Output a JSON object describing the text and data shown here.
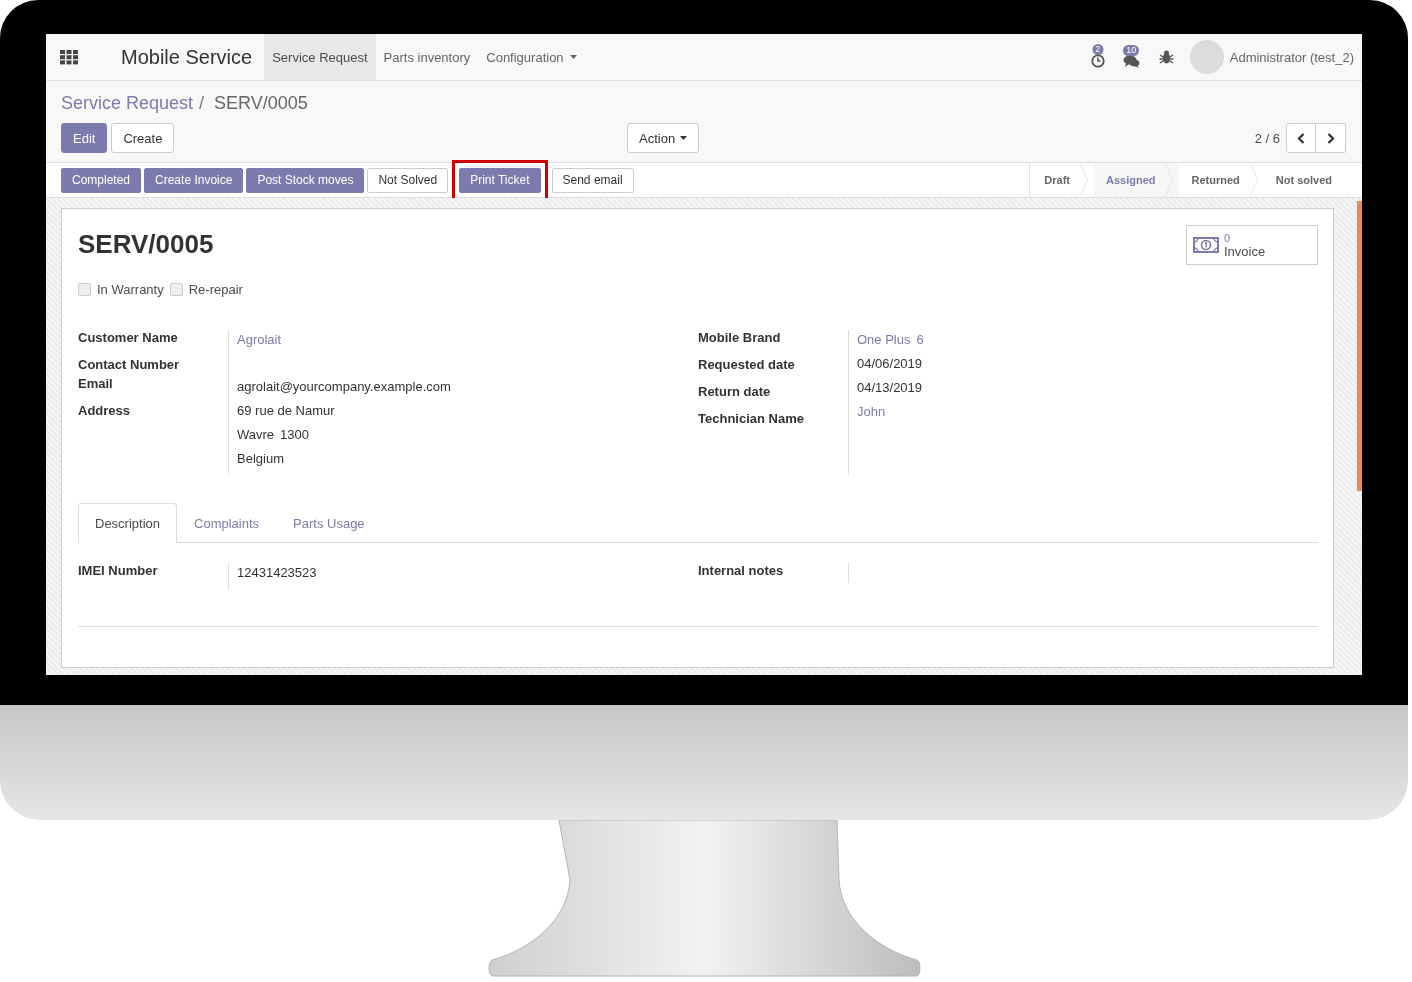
{
  "navbar": {
    "app_title": "Mobile Service",
    "menus": [
      {
        "label": "Service Request",
        "selected": true,
        "dropdown": false
      },
      {
        "label": "Parts inventory",
        "selected": false,
        "dropdown": false
      },
      {
        "label": "Configuration",
        "selected": false,
        "dropdown": true
      }
    ],
    "activity_count": "2",
    "message_count": "10",
    "user": "Administrator (test_2)"
  },
  "breadcrumb": {
    "parent": "Service Request",
    "separator": "/",
    "current": "SERV/0005"
  },
  "actions": [
    {
      "label": "Edit",
      "primary": true
    },
    {
      "label": "Create",
      "primary": false
    }
  ],
  "action_menu": "Action",
  "pager": "2 / 6",
  "header_buttons": [
    {
      "label": "Completed",
      "primary": true,
      "highlighted": false
    },
    {
      "label": "Create Invoice",
      "primary": true,
      "highlighted": false
    },
    {
      "label": "Post Stock moves",
      "primary": true,
      "highlighted": false
    },
    {
      "label": "Not Solved",
      "primary": false,
      "highlighted": false
    },
    {
      "label": "Print Ticket",
      "primary": true,
      "highlighted": true
    },
    {
      "label": "Send email",
      "primary": false,
      "highlighted": false
    }
  ],
  "statuses": [
    {
      "label": "Draft",
      "selected": false
    },
    {
      "label": "Assigned",
      "selected": true
    },
    {
      "label": "Returned",
      "selected": false
    },
    {
      "label": "Not solved",
      "selected": false
    }
  ],
  "sheet": {
    "title": "SERV/0005",
    "checkboxes": [
      {
        "label": "In Warranty",
        "checked": false
      },
      {
        "label": "Re-repair",
        "checked": false
      }
    ],
    "smart_button": {
      "count": "0",
      "label": "Invoice"
    },
    "left_fields": [
      {
        "label": "Customer Name",
        "link": true,
        "lines": [
          [
            "Agrolait"
          ]
        ]
      },
      {
        "label": "Contact Number"
      },
      {
        "label": "Email",
        "link": false,
        "lines": [
          [
            "agrolait@yourcompany.example.com"
          ]
        ]
      },
      {
        "label": "Address",
        "link": false,
        "lines": [
          [
            "69 rue de Namur"
          ],
          [
            "Wavre",
            "1300"
          ],
          [
            "Belgium"
          ]
        ]
      }
    ],
    "right_fields": [
      {
        "label": "Mobile Brand",
        "link": true,
        "lines": [
          [
            "One Plus",
            "6"
          ]
        ]
      },
      {
        "label": "Requested date",
        "link": false,
        "lines": [
          [
            "04/06/2019"
          ]
        ]
      },
      {
        "label": "Return date",
        "link": false,
        "lines": [
          [
            "04/13/2019"
          ]
        ]
      },
      {
        "label": "Technician Name",
        "link": true,
        "lines": [
          [
            "John"
          ]
        ]
      }
    ],
    "tabs": [
      {
        "label": "Description",
        "selected": true
      },
      {
        "label": "Complaints",
        "selected": false
      },
      {
        "label": "Parts Usage",
        "selected": false
      }
    ],
    "tab_left": {
      "label": "IMEI Number",
      "value": "12431423523"
    },
    "tab_right": {
      "label": "Internal notes"
    }
  }
}
